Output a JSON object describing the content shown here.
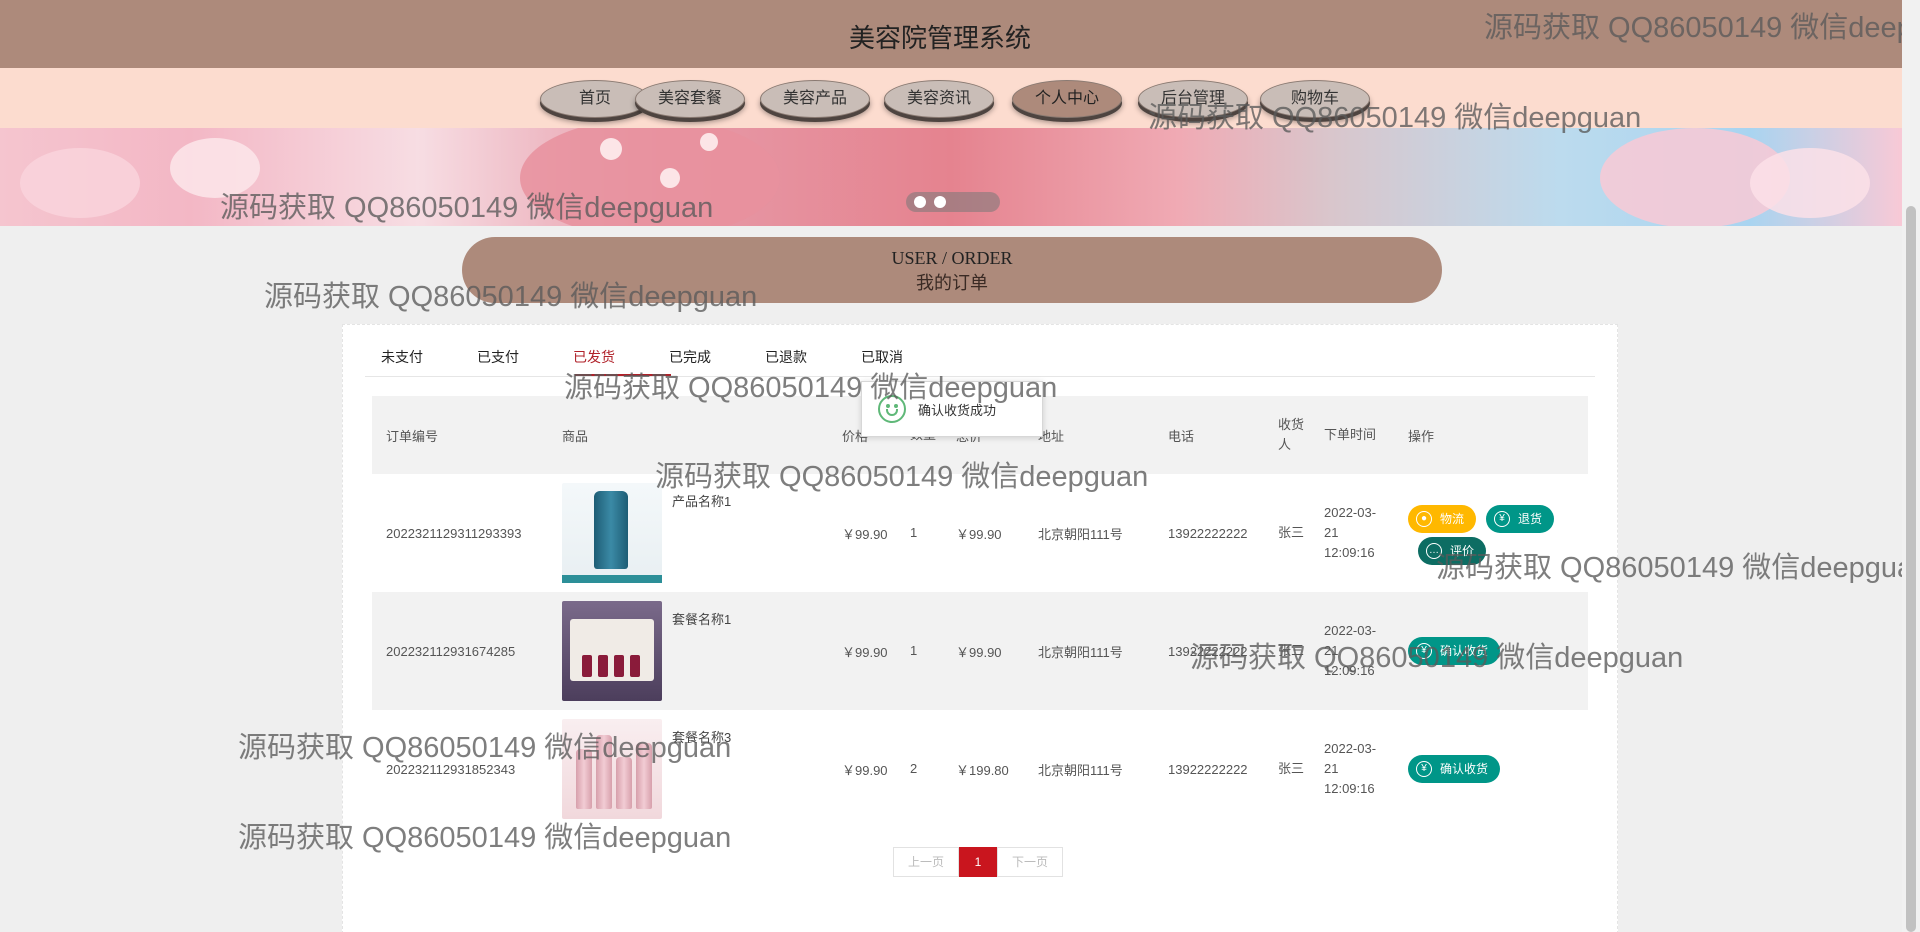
{
  "site": {
    "title": "美容院管理系统"
  },
  "nav": {
    "items": [
      "首页",
      "美容套餐",
      "美容产品",
      "美容资讯",
      "个人中心",
      "后台管理",
      "购物车"
    ],
    "active_index": 4
  },
  "section": {
    "title_en": "USER / ORDER",
    "title_cn": "我的订单"
  },
  "tabs": {
    "items": [
      "未支付",
      "已支付",
      "已发货",
      "已完成",
      "已退款",
      "已取消"
    ],
    "active_index": 2
  },
  "toast": {
    "message": "确认收货成功"
  },
  "table": {
    "headers": {
      "order_no": "订单编号",
      "product": "商品",
      "price": "价格",
      "qty": "数量",
      "total": "总价",
      "address": "地址",
      "phone": "电话",
      "receiver": "收货人",
      "time": "下单时间",
      "ops": "操作"
    },
    "rows": [
      {
        "order_no": "2022321129311293393",
        "product": "产品名称1",
        "price": "￥99.90",
        "qty": "1",
        "total": "￥99.90",
        "address": "北京朝阳111号",
        "phone": "13922222222",
        "receiver": "张三",
        "time": "2022-03-21 12:09:16"
      },
      {
        "order_no": "202232112931674285",
        "product": "套餐名称1",
        "price": "￥99.90",
        "qty": "1",
        "total": "￥99.90",
        "address": "北京朝阳111号",
        "phone": "13922222222",
        "receiver": "张三",
        "time": "2022-03-21 12:09:16"
      },
      {
        "order_no": "202232112931852343",
        "product": "套餐名称3",
        "price": "￥99.90",
        "qty": "2",
        "total": "￥199.80",
        "address": "北京朝阳111号",
        "phone": "13922222222",
        "receiver": "张三",
        "time": "2022-03-21 12:09:16"
      }
    ]
  },
  "buttons": {
    "logistics": "物流",
    "refund": "退货",
    "review": "评价",
    "confirm": "确认收货"
  },
  "pager": {
    "prev": "上一页",
    "current": "1",
    "next": "下一页"
  },
  "watermark": {
    "text": "源码获取 QQ86050149 微信deepguan"
  },
  "colors": {
    "header": "#ad8a7b",
    "nav_bg": "#fcdccf",
    "active_tab": "#b0222a",
    "green": "#009688",
    "yellow": "#ffb800",
    "pager_current": "#c9151e"
  }
}
